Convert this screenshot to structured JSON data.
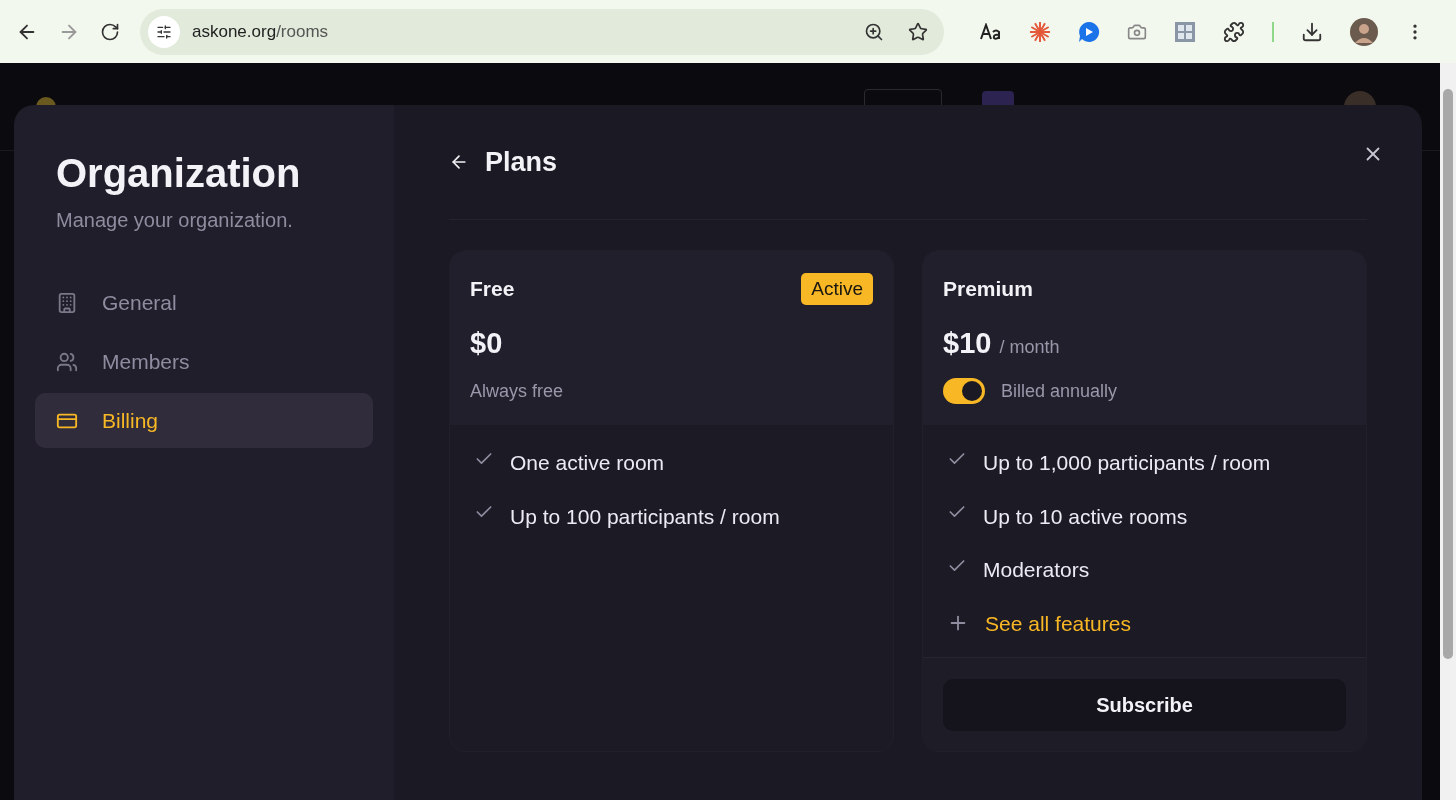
{
  "browser": {
    "url_host": "askone.org",
    "url_path": "/rooms"
  },
  "sidebar": {
    "title": "Organization",
    "subtitle": "Manage your organization.",
    "items": [
      {
        "label": "General",
        "selected": false
      },
      {
        "label": "Members",
        "selected": false
      },
      {
        "label": "Billing",
        "selected": true
      }
    ]
  },
  "page": {
    "title": "Plans"
  },
  "plans": [
    {
      "name": "Free",
      "badge": "Active",
      "price": "$0",
      "note": "Always free",
      "features": [
        {
          "kind": "check",
          "label": "One active room"
        },
        {
          "kind": "check",
          "label": "Up to 100 participants / room"
        }
      ]
    },
    {
      "name": "Premium",
      "price": "$10",
      "period": "/ month",
      "note": "Billed annually",
      "toggle": {
        "on": true
      },
      "features": [
        {
          "kind": "check",
          "label": "Up to 1,000 participants / room"
        },
        {
          "kind": "check",
          "label": "Up to 10 active rooms"
        },
        {
          "kind": "check",
          "label": "Moderators"
        },
        {
          "kind": "link",
          "label": "See all features"
        }
      ],
      "button": "Subscribe"
    }
  ]
}
